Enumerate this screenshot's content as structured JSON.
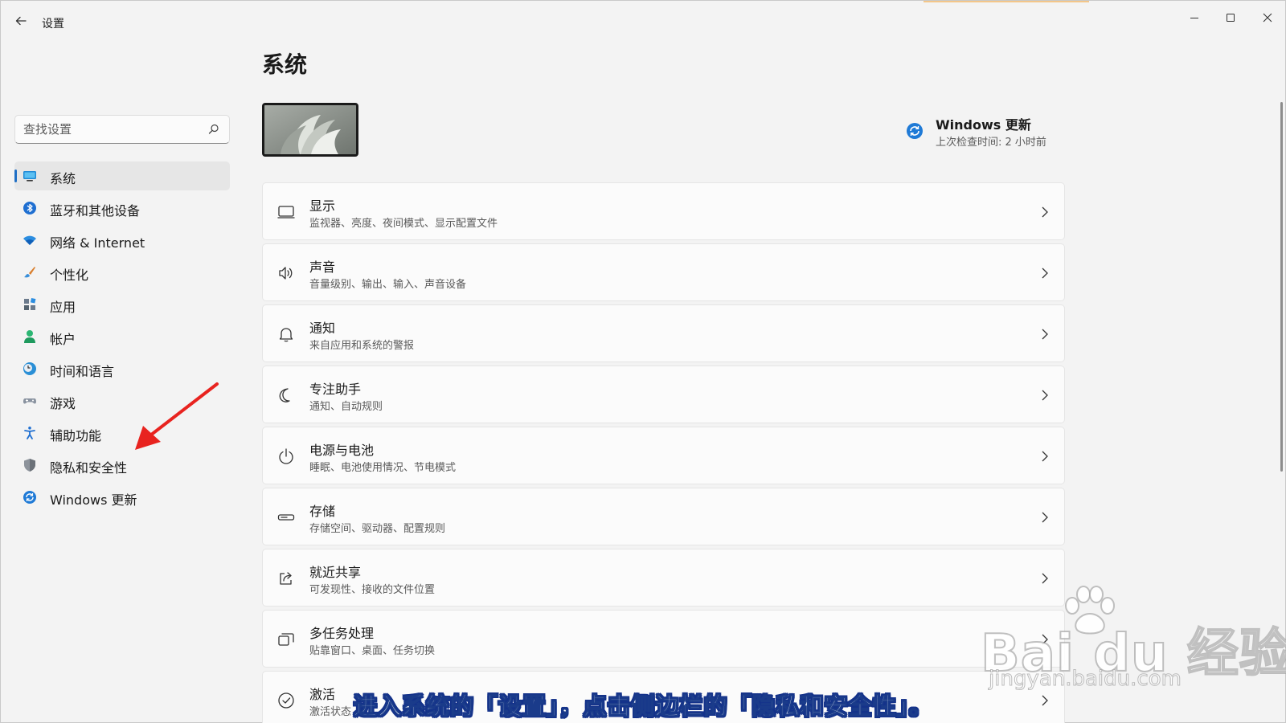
{
  "window": {
    "title": "设置"
  },
  "search": {
    "placeholder": "查找设置"
  },
  "sidebar": {
    "items": [
      {
        "label": "系统",
        "icon": "monitor-icon",
        "active": true
      },
      {
        "label": "蓝牙和其他设备",
        "icon": "bluetooth-icon"
      },
      {
        "label": "网络 & Internet",
        "icon": "wifi-icon"
      },
      {
        "label": "个性化",
        "icon": "brush-icon"
      },
      {
        "label": "应用",
        "icon": "apps-icon"
      },
      {
        "label": "帐户",
        "icon": "account-icon"
      },
      {
        "label": "时间和语言",
        "icon": "globe-clock-icon"
      },
      {
        "label": "游戏",
        "icon": "gamepad-icon"
      },
      {
        "label": "辅助功能",
        "icon": "accessibility-icon"
      },
      {
        "label": "隐私和安全性",
        "icon": "shield-icon"
      },
      {
        "label": "Windows 更新",
        "icon": "update-icon"
      }
    ]
  },
  "main": {
    "title": "系统",
    "update": {
      "title": "Windows 更新",
      "subtitle": "上次检查时间: 2 小时前"
    },
    "cards": [
      {
        "title": "显示",
        "subtitle": "监视器、亮度、夜间模式、显示配置文件",
        "icon": "display-icon"
      },
      {
        "title": "声音",
        "subtitle": "音量级别、输出、输入、声音设备",
        "icon": "speaker-icon"
      },
      {
        "title": "通知",
        "subtitle": "来自应用和系统的警报",
        "icon": "bell-icon"
      },
      {
        "title": "专注助手",
        "subtitle": "通知、自动规则",
        "icon": "moon-icon"
      },
      {
        "title": "电源与电池",
        "subtitle": "睡眠、电池使用情况、节电模式",
        "icon": "power-icon"
      },
      {
        "title": "存储",
        "subtitle": "存储空间、驱动器、配置规则",
        "icon": "storage-icon"
      },
      {
        "title": "就近共享",
        "subtitle": "可发现性、接收的文件位置",
        "icon": "share-icon"
      },
      {
        "title": "多任务处理",
        "subtitle": "贴靠窗口、桌面、任务切换",
        "icon": "multitask-icon"
      },
      {
        "title": "激活",
        "subtitle": "激活状态",
        "icon": "check-circle-icon"
      }
    ]
  },
  "overlay": {
    "caption": "进入系统的「设置」，点击侧边栏的「隐私和安全性」。",
    "watermark": "Bai du 经验",
    "watermark_url": "jingyan.baidu.com"
  },
  "colors": {
    "accent": "#1f6fc5",
    "arrow": "#e8231f",
    "caption_outline": "#14328a"
  }
}
